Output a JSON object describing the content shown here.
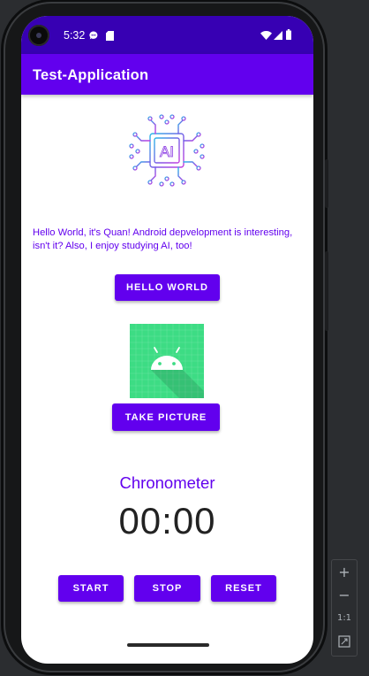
{
  "status_bar": {
    "time": "5:32",
    "icons": [
      "chat-bubble-icon",
      "sd-card-icon",
      "wifi-icon",
      "cell-signal-icon",
      "battery-icon"
    ]
  },
  "app_bar": {
    "title": "Test-Application"
  },
  "main": {
    "logo_text": "AI",
    "hello_text": "Hello World, it's Quan! Android depvelopment is interesting, isn't it? Also, I enjoy studying AI, too!",
    "hello_button": "HELLO WORLD",
    "take_picture_button": "TAKE PICTURE",
    "chronometer_label": "Chronometer",
    "chronometer_value": "00:00",
    "start_button": "START",
    "stop_button": "STOP",
    "reset_button": "RESET"
  },
  "emulator_zoom": {
    "zoom_in": "+",
    "zoom_out": "−",
    "actual_size": "1:1"
  },
  "colors": {
    "primary": "#6200ee",
    "primary_dark": "#3700b3",
    "android_tile": "#3ddc84"
  }
}
